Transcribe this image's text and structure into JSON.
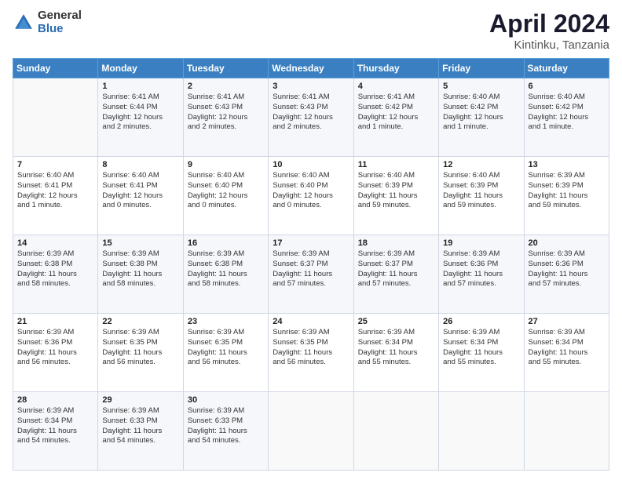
{
  "header": {
    "logo_general": "General",
    "logo_blue": "Blue",
    "main_title": "April 2024",
    "subtitle": "Kintinku, Tanzania"
  },
  "calendar": {
    "days_of_week": [
      "Sunday",
      "Monday",
      "Tuesday",
      "Wednesday",
      "Thursday",
      "Friday",
      "Saturday"
    ],
    "weeks": [
      [
        {
          "day": "",
          "info": ""
        },
        {
          "day": "1",
          "info": "Sunrise: 6:41 AM\nSunset: 6:44 PM\nDaylight: 12 hours\nand 2 minutes."
        },
        {
          "day": "2",
          "info": "Sunrise: 6:41 AM\nSunset: 6:43 PM\nDaylight: 12 hours\nand 2 minutes."
        },
        {
          "day": "3",
          "info": "Sunrise: 6:41 AM\nSunset: 6:43 PM\nDaylight: 12 hours\nand 2 minutes."
        },
        {
          "day": "4",
          "info": "Sunrise: 6:41 AM\nSunset: 6:42 PM\nDaylight: 12 hours\nand 1 minute."
        },
        {
          "day": "5",
          "info": "Sunrise: 6:40 AM\nSunset: 6:42 PM\nDaylight: 12 hours\nand 1 minute."
        },
        {
          "day": "6",
          "info": "Sunrise: 6:40 AM\nSunset: 6:42 PM\nDaylight: 12 hours\nand 1 minute."
        }
      ],
      [
        {
          "day": "7",
          "info": "Sunrise: 6:40 AM\nSunset: 6:41 PM\nDaylight: 12 hours\nand 1 minute."
        },
        {
          "day": "8",
          "info": "Sunrise: 6:40 AM\nSunset: 6:41 PM\nDaylight: 12 hours\nand 0 minutes."
        },
        {
          "day": "9",
          "info": "Sunrise: 6:40 AM\nSunset: 6:40 PM\nDaylight: 12 hours\nand 0 minutes."
        },
        {
          "day": "10",
          "info": "Sunrise: 6:40 AM\nSunset: 6:40 PM\nDaylight: 12 hours\nand 0 minutes."
        },
        {
          "day": "11",
          "info": "Sunrise: 6:40 AM\nSunset: 6:39 PM\nDaylight: 11 hours\nand 59 minutes."
        },
        {
          "day": "12",
          "info": "Sunrise: 6:40 AM\nSunset: 6:39 PM\nDaylight: 11 hours\nand 59 minutes."
        },
        {
          "day": "13",
          "info": "Sunrise: 6:39 AM\nSunset: 6:39 PM\nDaylight: 11 hours\nand 59 minutes."
        }
      ],
      [
        {
          "day": "14",
          "info": "Sunrise: 6:39 AM\nSunset: 6:38 PM\nDaylight: 11 hours\nand 58 minutes."
        },
        {
          "day": "15",
          "info": "Sunrise: 6:39 AM\nSunset: 6:38 PM\nDaylight: 11 hours\nand 58 minutes."
        },
        {
          "day": "16",
          "info": "Sunrise: 6:39 AM\nSunset: 6:38 PM\nDaylight: 11 hours\nand 58 minutes."
        },
        {
          "day": "17",
          "info": "Sunrise: 6:39 AM\nSunset: 6:37 PM\nDaylight: 11 hours\nand 57 minutes."
        },
        {
          "day": "18",
          "info": "Sunrise: 6:39 AM\nSunset: 6:37 PM\nDaylight: 11 hours\nand 57 minutes."
        },
        {
          "day": "19",
          "info": "Sunrise: 6:39 AM\nSunset: 6:36 PM\nDaylight: 11 hours\nand 57 minutes."
        },
        {
          "day": "20",
          "info": "Sunrise: 6:39 AM\nSunset: 6:36 PM\nDaylight: 11 hours\nand 57 minutes."
        }
      ],
      [
        {
          "day": "21",
          "info": "Sunrise: 6:39 AM\nSunset: 6:36 PM\nDaylight: 11 hours\nand 56 minutes."
        },
        {
          "day": "22",
          "info": "Sunrise: 6:39 AM\nSunset: 6:35 PM\nDaylight: 11 hours\nand 56 minutes."
        },
        {
          "day": "23",
          "info": "Sunrise: 6:39 AM\nSunset: 6:35 PM\nDaylight: 11 hours\nand 56 minutes."
        },
        {
          "day": "24",
          "info": "Sunrise: 6:39 AM\nSunset: 6:35 PM\nDaylight: 11 hours\nand 56 minutes."
        },
        {
          "day": "25",
          "info": "Sunrise: 6:39 AM\nSunset: 6:34 PM\nDaylight: 11 hours\nand 55 minutes."
        },
        {
          "day": "26",
          "info": "Sunrise: 6:39 AM\nSunset: 6:34 PM\nDaylight: 11 hours\nand 55 minutes."
        },
        {
          "day": "27",
          "info": "Sunrise: 6:39 AM\nSunset: 6:34 PM\nDaylight: 11 hours\nand 55 minutes."
        }
      ],
      [
        {
          "day": "28",
          "info": "Sunrise: 6:39 AM\nSunset: 6:34 PM\nDaylight: 11 hours\nand 54 minutes."
        },
        {
          "day": "29",
          "info": "Sunrise: 6:39 AM\nSunset: 6:33 PM\nDaylight: 11 hours\nand 54 minutes."
        },
        {
          "day": "30",
          "info": "Sunrise: 6:39 AM\nSunset: 6:33 PM\nDaylight: 11 hours\nand 54 minutes."
        },
        {
          "day": "",
          "info": ""
        },
        {
          "day": "",
          "info": ""
        },
        {
          "day": "",
          "info": ""
        },
        {
          "day": "",
          "info": ""
        }
      ]
    ]
  }
}
